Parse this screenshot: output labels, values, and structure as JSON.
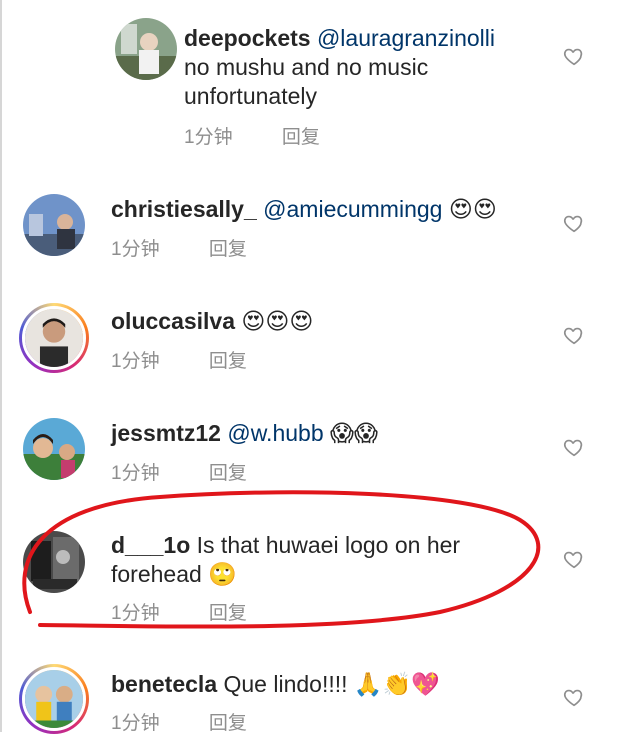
{
  "comments": [
    {
      "username": "deepockets",
      "mention": "@lauragranzinolli",
      "body_line1": "no mushu and no music",
      "body_line2": "unfortunately",
      "time": "1分钟",
      "reply": "回复"
    },
    {
      "username": "christiesally_",
      "mention": "@amiecummingg",
      "emojis": "😍😍",
      "time": "1分钟",
      "reply": "回复"
    },
    {
      "username": "olucca​silva",
      "emojis": "😍😍😍",
      "time": "1分钟",
      "reply": "回复"
    },
    {
      "username": "jessmtz12",
      "mention": "@w.hubb",
      "emojis": "😱😱",
      "time": "1分钟",
      "reply": "回复"
    },
    {
      "username": "d___1o",
      "body_line1": "Is that huwaei logo on her",
      "body_line2": "forehead",
      "emojis": "🙄",
      "time": "1分钟",
      "reply": "回复"
    },
    {
      "username": "benetecla",
      "body_line1": "Que lindo!!!!",
      "emojis": "🙏👏💖",
      "time": "1分钟",
      "reply": "回复"
    }
  ],
  "colors": {
    "text": "#262626",
    "mention": "#003569",
    "meta": "#8e8e8e",
    "annotation": "#e0161b"
  },
  "icons": [
    "heart-outline-icon"
  ]
}
